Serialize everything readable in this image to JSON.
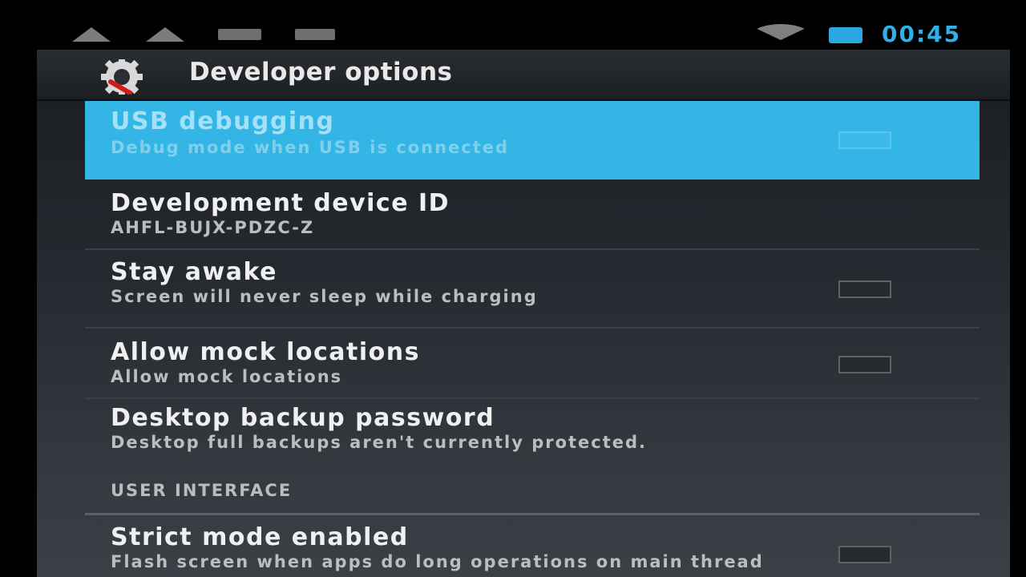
{
  "status_bar": {
    "icons": [
      "warning-icon",
      "warning-icon",
      "picture-icon",
      "notification-icon",
      "wifi-icon",
      "battery-icon"
    ],
    "time": "00:45",
    "accent_color": "#2fb0e8"
  },
  "action_bar": {
    "icon": "developer-gear-icon",
    "title": "Developer options"
  },
  "settings": [
    {
      "title": "USB debugging",
      "summary": "Debug mode when USB is connected",
      "has_checkbox": true,
      "selected": true
    },
    {
      "title": "Development device ID",
      "summary": "AHFL-BUJX-PDZC-Z",
      "has_checkbox": false
    },
    {
      "title": "Stay awake",
      "summary": "Screen will never sleep while charging",
      "has_checkbox": true
    },
    {
      "title": "Allow mock locations",
      "summary": "Allow mock locations",
      "has_checkbox": true
    },
    {
      "title": "Desktop backup password",
      "summary": "Desktop full backups aren't currently protected.",
      "has_checkbox": false
    }
  ],
  "section_header": "USER INTERFACE",
  "settings_ui": [
    {
      "title": "Strict mode enabled",
      "summary": "Flash screen when apps do long operations on main thread",
      "has_checkbox": true
    }
  ],
  "colors": {
    "selection": "#33b5e5",
    "background": "#24292f"
  }
}
